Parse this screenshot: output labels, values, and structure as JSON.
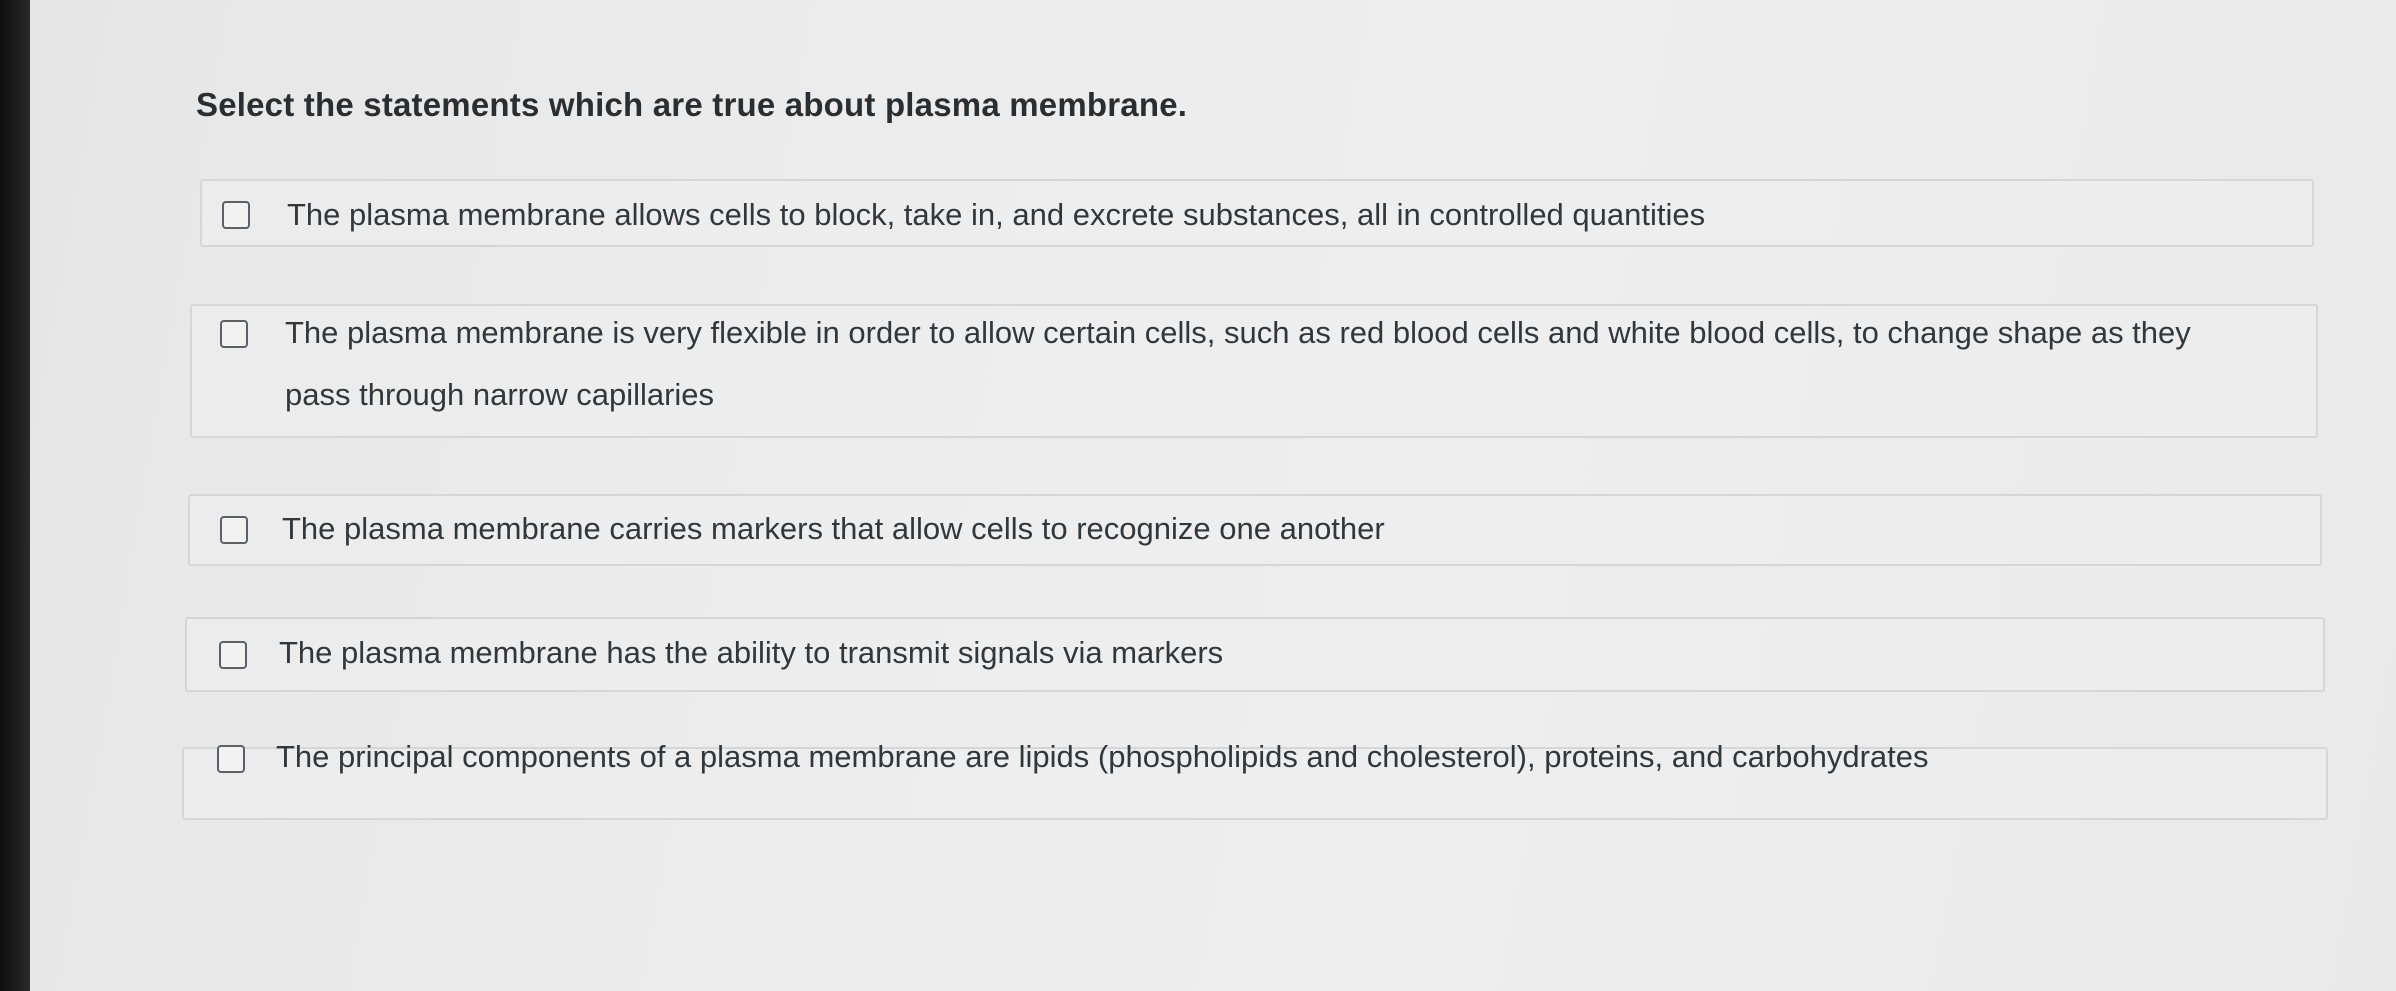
{
  "question": {
    "text": "Select the statements which are true about plasma membrane."
  },
  "options": [
    {
      "text": "The plasma membrane allows cells to block, take in, and excrete substances, all in controlled quantities",
      "checked": false
    },
    {
      "text_line1": "The plasma membrane is very flexible in order to allow certain cells, such as red blood cells and white blood cells, to change shape as they",
      "text_line2": "pass through narrow capillaries",
      "checked": false
    },
    {
      "text": "The plasma membrane carries markers that allow cells to recognize one another",
      "checked": false
    },
    {
      "text": "The plasma membrane has the ability to transmit signals via markers",
      "checked": false
    },
    {
      "text": "The principal components of a plasma membrane are lipids (phospholipids and cholesterol), proteins, and carbohydrates",
      "checked": false
    }
  ]
}
